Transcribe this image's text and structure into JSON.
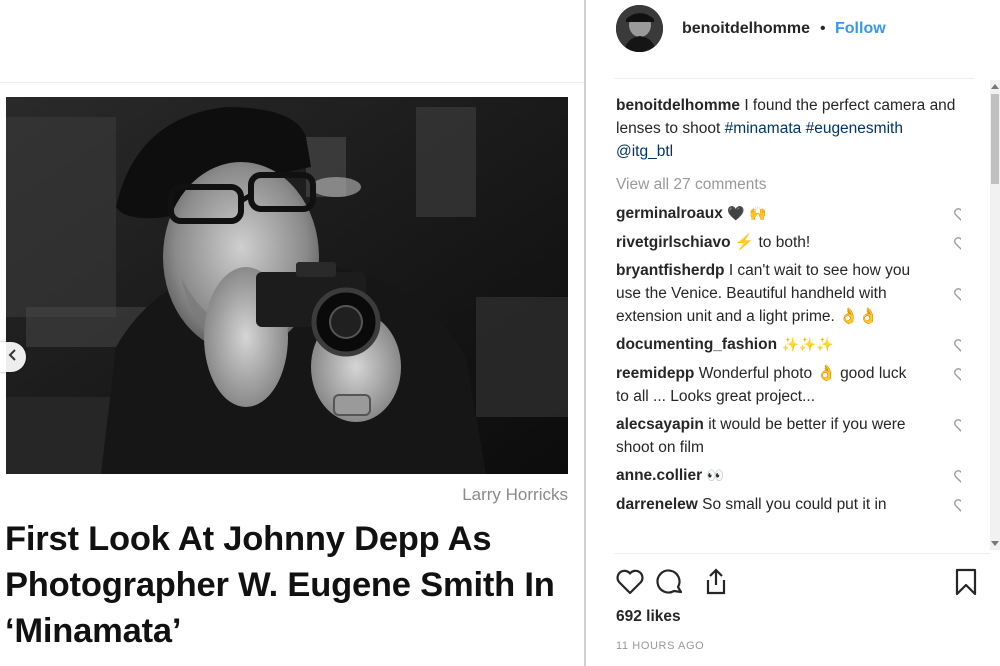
{
  "article": {
    "photo_credit": "Larry Horricks",
    "headline": "First Look At Johnny Depp As Photographer W. Eugene Smith In ‘Minamata’"
  },
  "post": {
    "owner": "benoitdelhomme",
    "separator": "•",
    "follow_label": "Follow",
    "caption": {
      "user": "benoitdelhomme",
      "text": " I found the perfect camera and lenses to shoot ",
      "tag1": "#minamata",
      "tag2": "#eugenesmith",
      "tag3": "@itg_btl"
    },
    "view_all": "View all 27 comments",
    "comments": [
      {
        "user": "germinalroaux",
        "text": " 🖤 🙌"
      },
      {
        "user": "rivetgirlschiavo",
        "text": " ⚡ to both!"
      },
      {
        "user": "bryantfisherdp",
        "text": " I can't wait to see how you use the Venice. Beautiful handheld with extension unit and a light prime. 👌👌"
      },
      {
        "user": "documenting_fashion",
        "text": " ✨✨✨"
      },
      {
        "user": "reemidepp",
        "text": " Wonderful photo 👌 good luck to all ... Looks great project..."
      },
      {
        "user": "alecsayapin",
        "text": " it would be better if you were shoot on film"
      },
      {
        "user": "anne.collier",
        "text": " 👀"
      },
      {
        "user": "darrenelew",
        "text": " So small you could put it in"
      }
    ],
    "likes": "692 likes",
    "time": "11 HOURS AGO",
    "icons": {
      "like": "heart-icon",
      "comment": "comment-icon",
      "share": "share-icon",
      "save": "bookmark-icon",
      "prev": "chevron-left-icon"
    },
    "colors": {
      "follow": "#3897f0",
      "tag": "#003569",
      "muted": "#999999"
    }
  }
}
